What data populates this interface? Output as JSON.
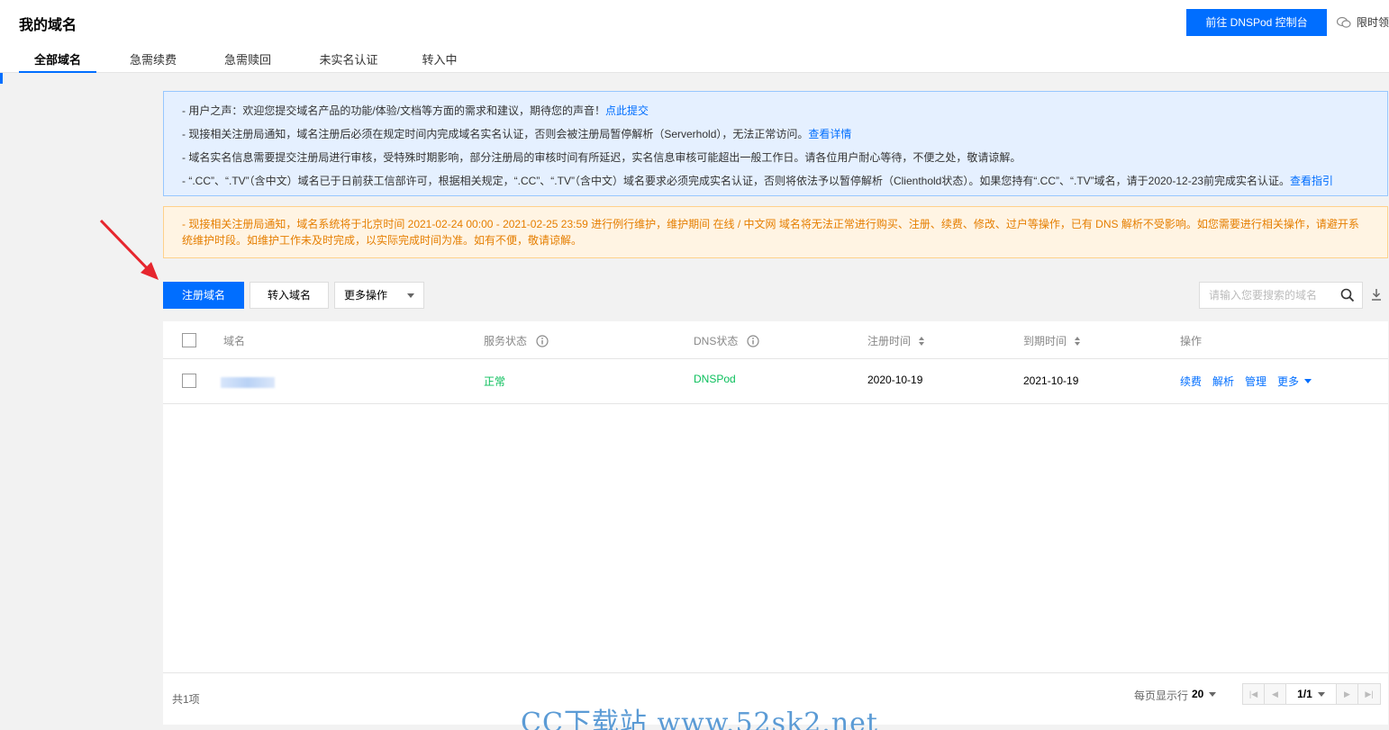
{
  "header": {
    "title": "我的域名",
    "dnspod_button": "前往 DNSPod 控制台",
    "promo_text": "限时领"
  },
  "tabs": [
    {
      "label": "全部域名",
      "active": true
    },
    {
      "label": "急需续费",
      "active": false
    },
    {
      "label": "急需赎回",
      "active": false
    },
    {
      "label": "未实名认证",
      "active": false
    },
    {
      "label": "转入中",
      "active": false
    }
  ],
  "notice_blue": {
    "line1": "- 用户之声：欢迎您提交域名产品的功能/体验/文档等方面的需求和建议，期待您的声音！",
    "line1_link": "点此提交",
    "line2": "- 现接相关注册局通知，域名注册后必须在规定时间内完成域名实名认证，否则会被注册局暂停解析（Serverhold），无法正常访问。",
    "line2_link": "查看详情",
    "line3": "- 域名实名信息需要提交注册局进行审核，受特殊时期影响，部分注册局的审核时间有所延迟，实名信息审核可能超出一般工作日。请各位用户耐心等待，不便之处，敬请谅解。",
    "line4": "- “.CC”、“.TV”（含中文）域名已于日前获工信部许可，根据相关规定，“.CC”、“.TV”（含中文）域名要求必须完成实名认证，否则将依法予以暂停解析（Clienthold状态）。如果您持有“.CC”、“.TV”域名，请于2020-12-23前完成实名认证。",
    "line4_link": "查看指引"
  },
  "notice_orange": {
    "text": "- 现接相关注册局通知，域名系统将于北京时间 2021-02-24 00:00 - 2021-02-25 23:59 进行例行维护，维护期间 在线 / 中文网 域名将无法正常进行购买、注册、续费、修改、过户等操作，已有 DNS 解析不受影响。如您需要进行相关操作，请避开系统维护时段。如维护工作未及时完成，以实际完成时间为准。如有不便，敬请谅解。"
  },
  "toolbar": {
    "register_button": "注册域名",
    "transfer_button": "转入域名",
    "more_ops": "更多操作",
    "search_placeholder": "请输入您要搜索的域名"
  },
  "table": {
    "columns": {
      "domain": "域名",
      "service_status": "服务状态",
      "dns_status": "DNS状态",
      "reg_time": "注册时间",
      "exp_time": "到期时间",
      "ops": "操作"
    },
    "rows": [
      {
        "service_status": "正常",
        "dns_status": "DNSPod",
        "reg_time": "2020-10-19",
        "exp_time": "2021-10-19",
        "op_renew": "续费",
        "op_resolve": "解析",
        "op_manage": "管理",
        "op_more": "更多"
      }
    ]
  },
  "footer": {
    "total": "共1项",
    "pagesize_label": "每页显示行",
    "pagesize": "20",
    "page": "1/1"
  },
  "watermark": "CC下载站 www.52sk2.net",
  "colors": {
    "primary": "#006eff",
    "success": "#0abf5b",
    "warning": "#e57e00"
  }
}
